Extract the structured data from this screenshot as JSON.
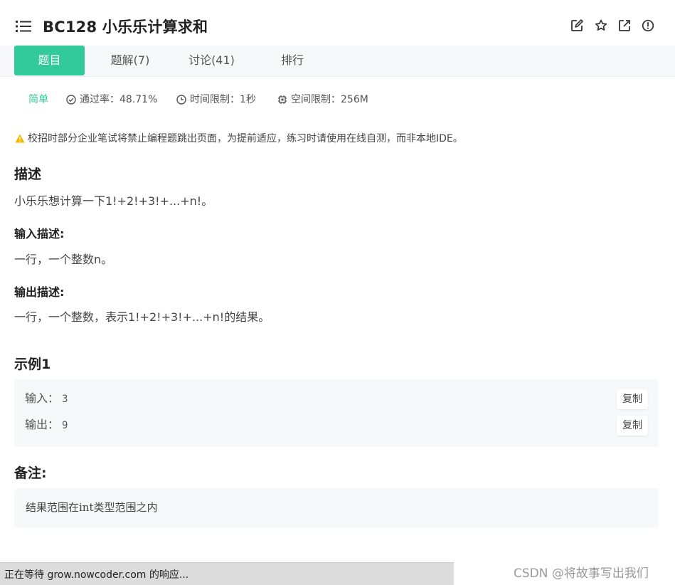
{
  "header": {
    "title": "BC128  小乐乐计算求和",
    "icons": [
      "list-icon",
      "edit-icon",
      "star-icon",
      "external-link-icon",
      "info-icon"
    ]
  },
  "tabs": [
    {
      "label": "题目",
      "active": true
    },
    {
      "label": "题解(7)",
      "active": false
    },
    {
      "label": "讨论(41)",
      "active": false
    },
    {
      "label": "排行",
      "active": false
    }
  ],
  "meta": {
    "level": "简单",
    "pass_rate": "通过率：48.71%",
    "time_limit": "时间限制：1秒",
    "space_limit": "空间限制：256M"
  },
  "notice": "校招时部分企业笔试将禁止编程题跳出页面，为提前适应，练习时请使用在线自测，而非本地IDE。",
  "description": {
    "heading": "描述",
    "text": "小乐乐想计算一下1!+2!+3!+...+n!。"
  },
  "input_desc": {
    "heading": "输入描述:",
    "text": "一行，一个整数n。"
  },
  "output_desc": {
    "heading": "输出描述:",
    "text": "一行，一个整数，表示1!+2!+3!+...+n!的结果。"
  },
  "example": {
    "heading": "示例1",
    "input_label": "输入：",
    "input_value": "3",
    "output_label": "输出：",
    "output_value": "9",
    "copy_label": "复制"
  },
  "note": {
    "heading": "备注:",
    "text": "结果范围在int类型范围之内"
  },
  "statusbar": {
    "text": "正在等待 grow.nowcoder.com 的响应..."
  },
  "watermark": "CSDN @将故事写出我们",
  "colors": {
    "accent": "#32ca99",
    "warning": "#f5b800",
    "panel_bg": "#f7f8fa"
  }
}
